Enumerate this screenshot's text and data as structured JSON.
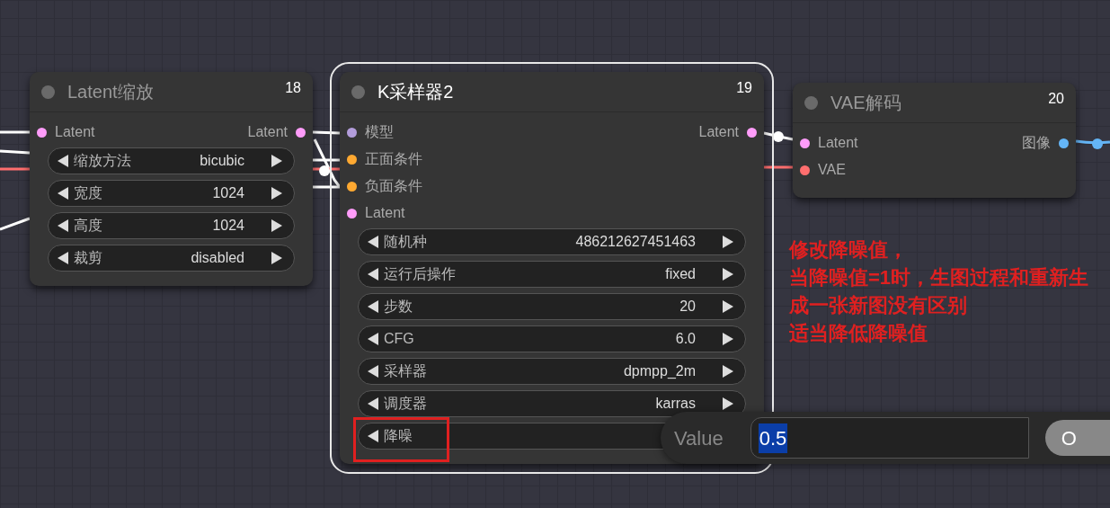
{
  "nodes": [
    {
      "id": "18",
      "title": "Latent缩放",
      "selected": false,
      "inputs": [
        {
          "label": "Latent",
          "color": "#ff9cf9"
        }
      ],
      "outputs": [
        {
          "label": "Latent",
          "color": "#ff9cf9"
        }
      ],
      "widgets": [
        {
          "label": "缩放方法",
          "value": "bicubic",
          "marked": false
        },
        {
          "label": "宽度",
          "value": "1024",
          "marked": false
        },
        {
          "label": "高度",
          "value": "1024",
          "marked": false
        },
        {
          "label": "裁剪",
          "value": "disabled",
          "marked": false
        }
      ]
    },
    {
      "id": "19",
      "title": "K采样器2",
      "selected": true,
      "inputs": [
        {
          "label": "模型",
          "color": "#b39ddb"
        },
        {
          "label": "正面条件",
          "color": "#ffa931"
        },
        {
          "label": "负面条件",
          "color": "#ffa931"
        },
        {
          "label": "Latent",
          "color": "#ff9cf9"
        }
      ],
      "outputs": [
        {
          "label": "Latent",
          "color": "#ff9cf9"
        }
      ],
      "widgets": [
        {
          "label": "随机种",
          "value": "486212627451463",
          "marked": false
        },
        {
          "label": "运行后操作",
          "value": "fixed",
          "marked": false
        },
        {
          "label": "步数",
          "value": "20",
          "marked": false
        },
        {
          "label": "CFG",
          "value": "6.0",
          "marked": false
        },
        {
          "label": "采样器",
          "value": "dpmpp_2m",
          "marked": false
        },
        {
          "label": "调度器",
          "value": "karras",
          "marked": false
        },
        {
          "label": "降噪",
          "marked": true
        }
      ]
    },
    {
      "id": "20",
      "title": "VAE解码",
      "selected": false,
      "inputs": [
        {
          "label": "Latent",
          "color": "#ff9cf9"
        },
        {
          "label": "VAE",
          "color": "#ff6e6e"
        }
      ],
      "outputs": [
        {
          "label": "图像",
          "color": "#64b5f6"
        }
      ]
    }
  ],
  "annotation": {
    "lines": [
      "修改降噪值，",
      "当降噪值=1时，生图过程和重新生成一张新图没有区别",
      "适当降低降噪值"
    ]
  },
  "prompt_dialog": {
    "label": "Value",
    "value": "0.5",
    "value_selected": true,
    "button": "O"
  }
}
